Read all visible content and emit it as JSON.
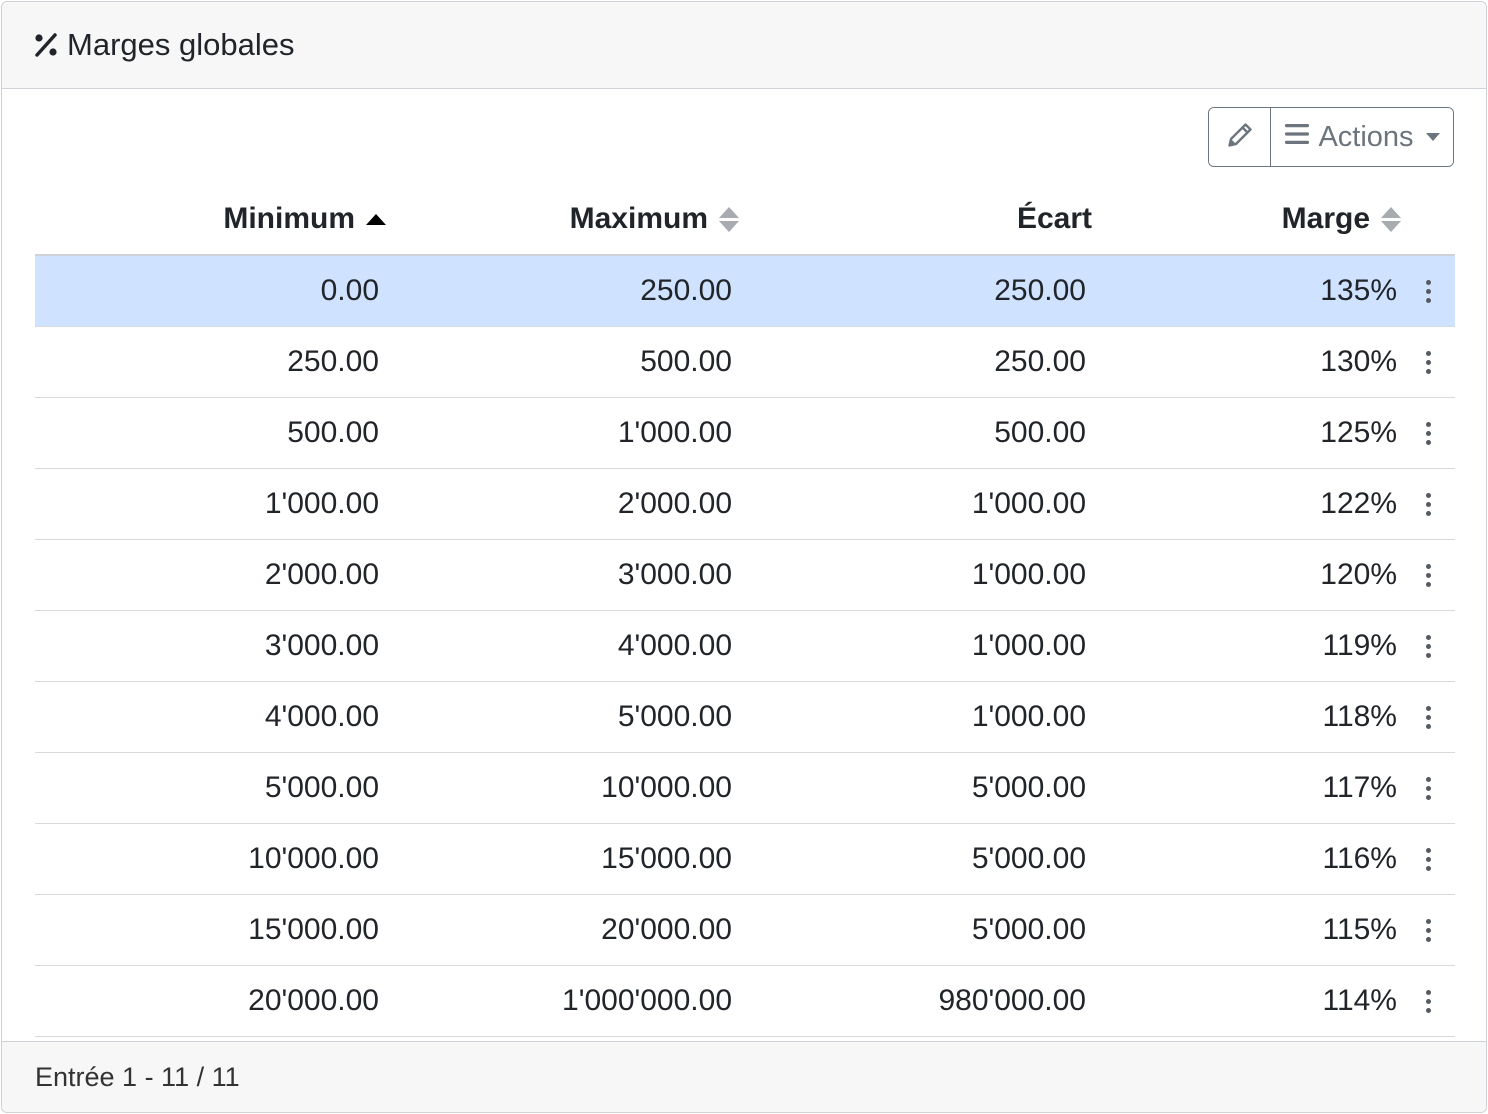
{
  "header": {
    "title": "Marges globales",
    "icon": "percent-icon"
  },
  "toolbar": {
    "edit_icon": "pencil-icon",
    "actions_icon": "bars-icon",
    "actions_label": "Actions"
  },
  "table": {
    "columns": [
      {
        "label": "Minimum",
        "sort": "asc"
      },
      {
        "label": "Maximum",
        "sort": "none"
      },
      {
        "label": "Écart",
        "sort": "disabled"
      },
      {
        "label": "Marge",
        "sort": "none"
      }
    ],
    "rows": [
      {
        "min": "0.00",
        "max": "250.00",
        "ecart": "250.00",
        "marge": "135%",
        "selected": true
      },
      {
        "min": "250.00",
        "max": "500.00",
        "ecart": "250.00",
        "marge": "130%"
      },
      {
        "min": "500.00",
        "max": "1'000.00",
        "ecart": "500.00",
        "marge": "125%"
      },
      {
        "min": "1'000.00",
        "max": "2'000.00",
        "ecart": "1'000.00",
        "marge": "122%"
      },
      {
        "min": "2'000.00",
        "max": "3'000.00",
        "ecart": "1'000.00",
        "marge": "120%"
      },
      {
        "min": "3'000.00",
        "max": "4'000.00",
        "ecart": "1'000.00",
        "marge": "119%"
      },
      {
        "min": "4'000.00",
        "max": "5'000.00",
        "ecart": "1'000.00",
        "marge": "118%"
      },
      {
        "min": "5'000.00",
        "max": "10'000.00",
        "ecart": "5'000.00",
        "marge": "117%"
      },
      {
        "min": "10'000.00",
        "max": "15'000.00",
        "ecart": "5'000.00",
        "marge": "116%"
      },
      {
        "min": "15'000.00",
        "max": "20'000.00",
        "ecart": "5'000.00",
        "marge": "115%"
      },
      {
        "min": "20'000.00",
        "max": "1'000'000.00",
        "ecart": "980'000.00",
        "marge": "114%"
      }
    ],
    "row_menu_icon": "kebab-menu-icon"
  },
  "footer": {
    "entries_text": "Entrée 1 - 11 / 11"
  },
  "colors": {
    "selected_row": "#cfe2ff",
    "header_bg": "#f7f7f7",
    "border": "#cfd2d6",
    "secondary": "#6c757d"
  }
}
